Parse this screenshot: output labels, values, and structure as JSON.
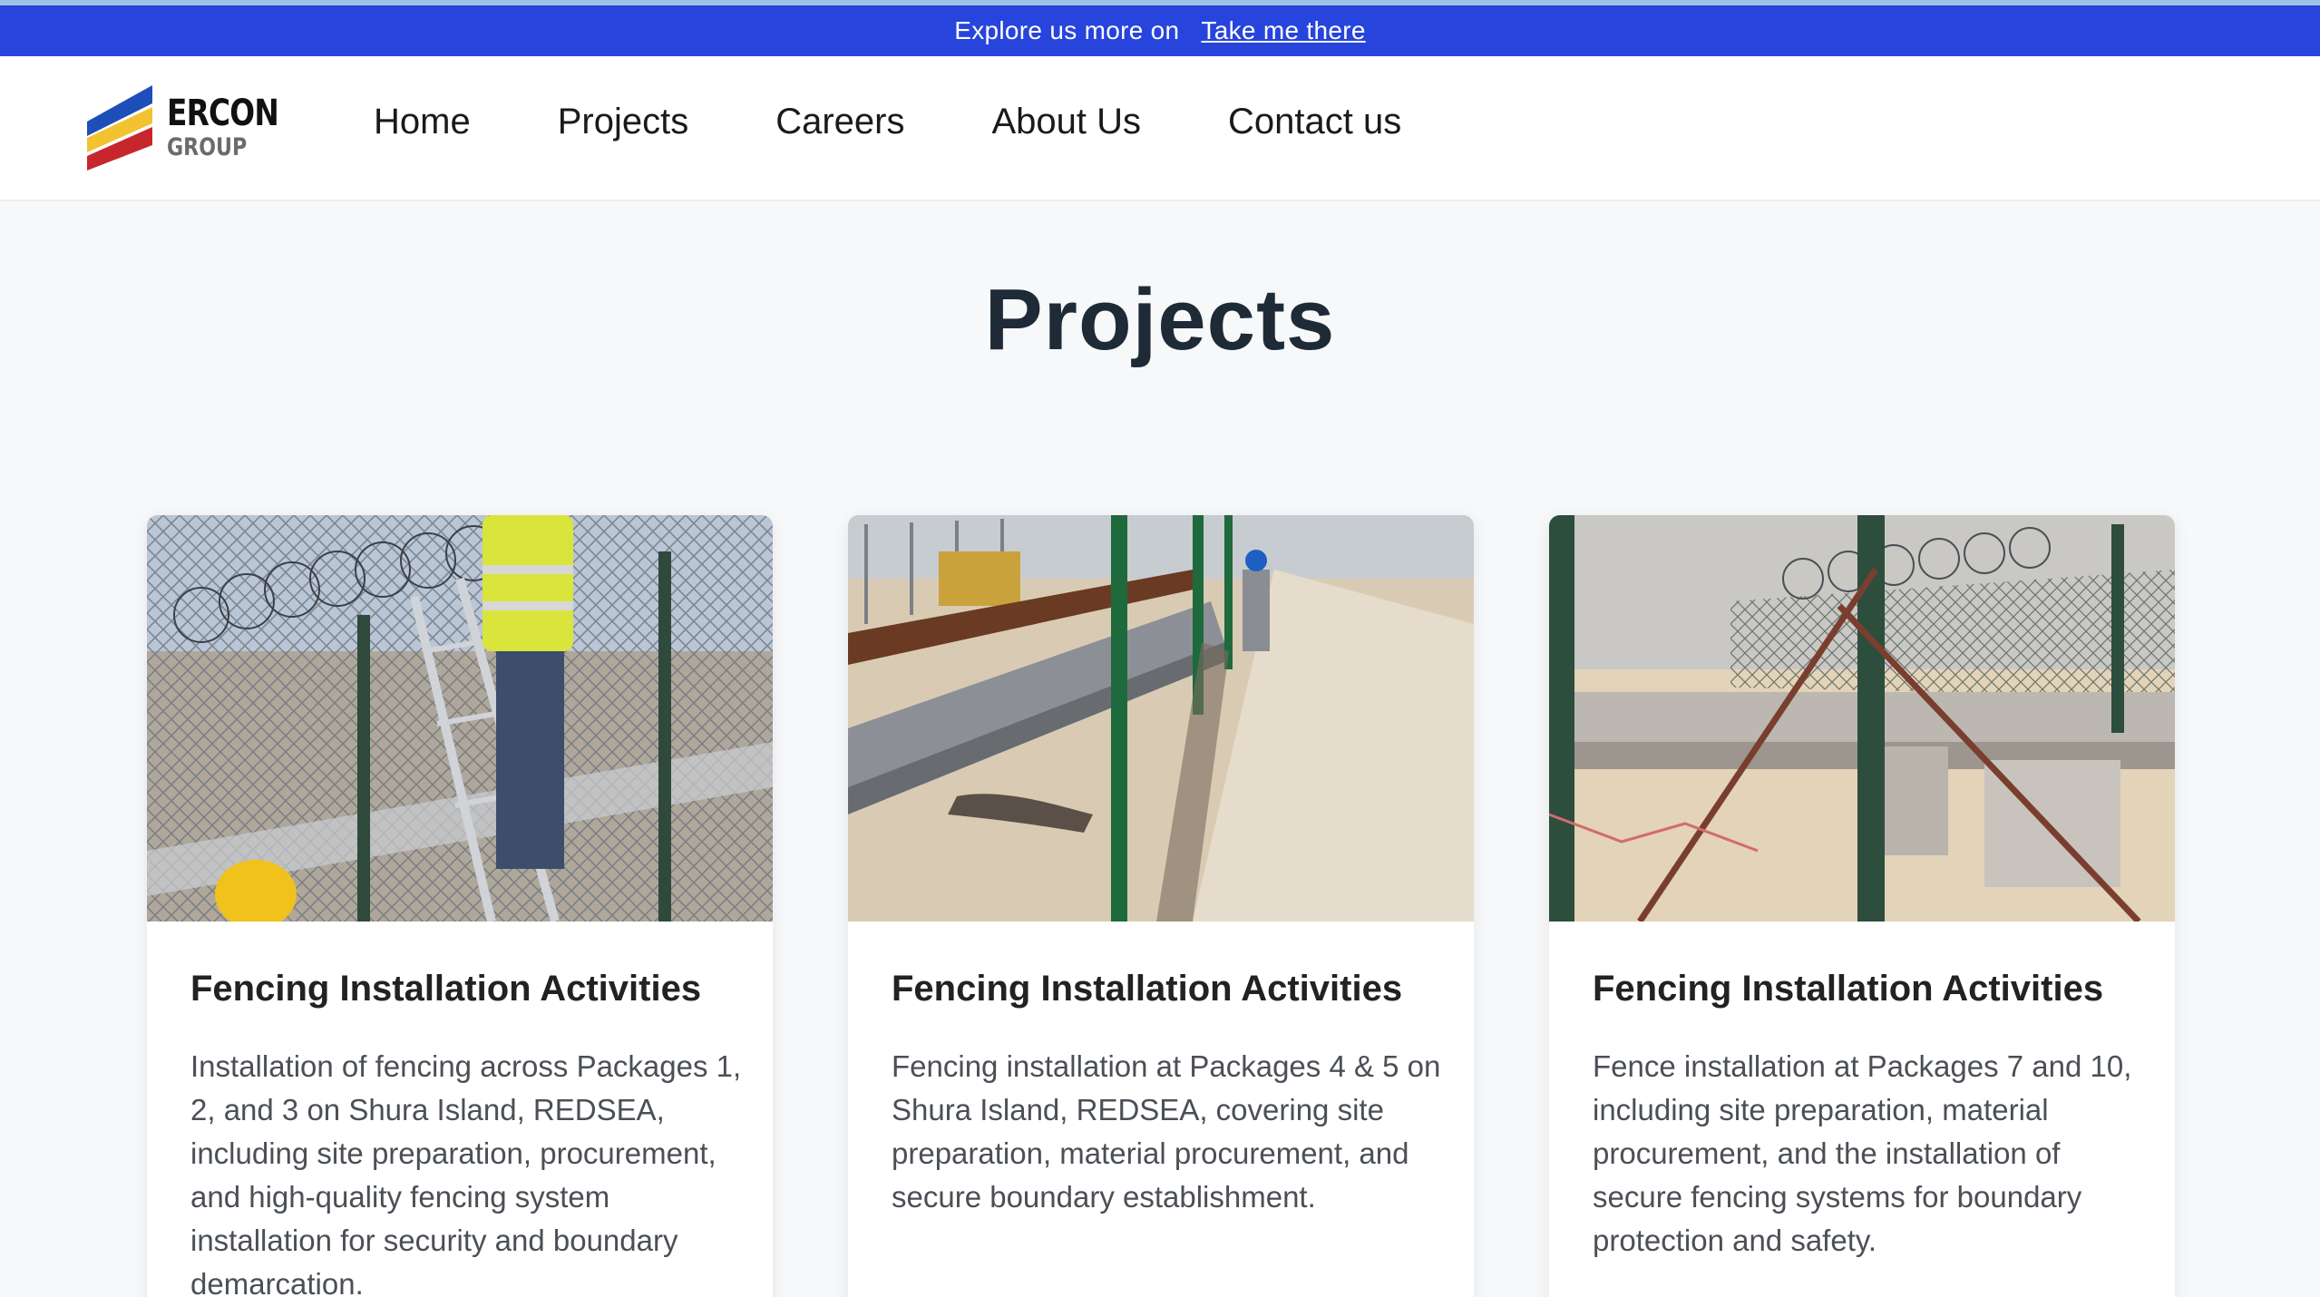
{
  "announcement": {
    "text": "Explore us more on",
    "link_label": "Take me there"
  },
  "logo": {
    "line1": "ERCON",
    "line2": "GROUP"
  },
  "nav": {
    "items": [
      {
        "label": "Home"
      },
      {
        "label": "Projects"
      },
      {
        "label": "Careers"
      },
      {
        "label": "About Us"
      },
      {
        "label": "Contact us"
      }
    ]
  },
  "page": {
    "title": "Projects"
  },
  "projects": [
    {
      "title": "Fencing Installation Activities",
      "description": "Installation of fencing across Packages 1, 2, and 3 on Shura Island, REDSEA, including site preparation, procurement, and high-quality fencing system installation for security and boundary demarcation."
    },
    {
      "title": "Fencing Installation Activities",
      "description": "Fencing installation at Packages 4 & 5 on Shura Island, REDSEA, covering site preparation, material procurement, and secure boundary establishment."
    },
    {
      "title": "Fencing Installation Activities",
      "description": "Fence installation at Packages 7 and 10, including site preparation, material procurement, and the installation of secure fencing systems for boundary protection and safety."
    }
  ],
  "colors": {
    "announcement_bg": "#2744dc",
    "logo_blue": "#1e4fb8",
    "logo_yellow": "#f2c230",
    "logo_red": "#c8262d"
  }
}
